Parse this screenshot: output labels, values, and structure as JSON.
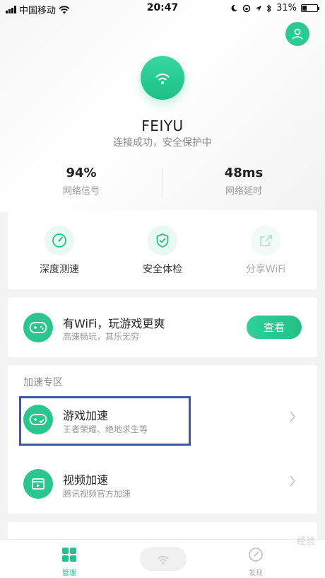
{
  "status_bar": {
    "carrier": "中国移动",
    "time": "20:47",
    "battery": "31%",
    "battery_level": 0.31
  },
  "network": {
    "ssid": "FEIYU",
    "status": "连接成功，安全保护中",
    "metrics": [
      {
        "value": "94%",
        "label": "网络信号"
      },
      {
        "value": "48ms",
        "label": "网络延时"
      }
    ]
  },
  "tools": [
    {
      "label": "深度测速",
      "icon": "speedometer-icon",
      "enabled": true
    },
    {
      "label": "安全体检",
      "icon": "shield-check-icon",
      "enabled": true
    },
    {
      "label": "分享WiFi",
      "icon": "share-icon",
      "enabled": false
    }
  ],
  "promo": {
    "title": "有WiFi，玩游戏更爽",
    "subtitle": "高速畅玩，其乐无穷",
    "button": "查看",
    "icon": "gamepad-icon"
  },
  "accel": {
    "heading": "加速专区",
    "items": [
      {
        "title": "游戏加速",
        "subtitle": "王者荣耀、绝地求生等",
        "icon": "gamepad-icon"
      },
      {
        "title": "视频加速",
        "subtitle": "腾讯视频官方加速",
        "icon": "video-icon"
      }
    ]
  },
  "tab_bar": {
    "manage": "管理",
    "discover": "发现"
  },
  "watermark": "经验",
  "colors": {
    "accent": "#2cc995",
    "highlight_box": "#3b5aa8"
  }
}
